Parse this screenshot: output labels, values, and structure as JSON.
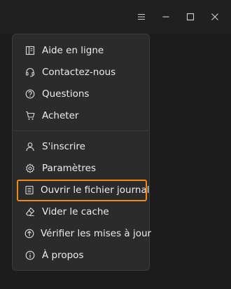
{
  "window": {
    "controls": [
      "menu-icon",
      "minimize-icon",
      "maximize-icon",
      "close-icon"
    ]
  },
  "menu": {
    "items": [
      {
        "label": "Aide en ligne",
        "icon": "book-icon"
      },
      {
        "label": "Contactez-nous",
        "icon": "headset-icon"
      },
      {
        "label": "Questions",
        "icon": "question-icon"
      },
      {
        "label": "Acheter",
        "icon": "cart-icon"
      },
      {
        "label": "S'inscrire",
        "icon": "user-icon"
      },
      {
        "label": "Paramètres",
        "icon": "gear-icon"
      },
      {
        "label": "Ouvrir le fichier journal",
        "icon": "document-icon"
      },
      {
        "label": "Vider le cache",
        "icon": "eraser-icon"
      },
      {
        "label": "Vérifier les mises à jour",
        "icon": "update-icon"
      },
      {
        "label": "À propos",
        "icon": "info-icon"
      }
    ],
    "highlighted_item": "Ouvrir le fichier journal",
    "highlight_color": "#f08a14"
  }
}
